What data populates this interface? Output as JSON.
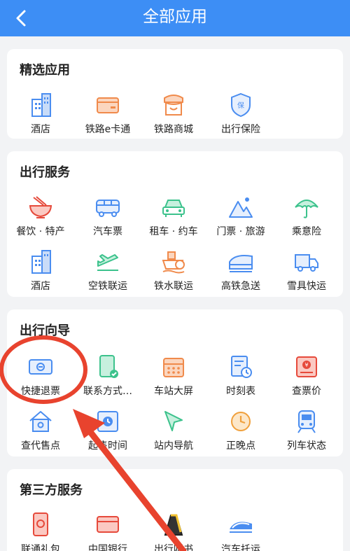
{
  "header": {
    "title": "全部应用",
    "back_icon": "chevron-left-icon"
  },
  "sections": [
    {
      "title": "精选应用",
      "items": [
        "酒店",
        "铁路e卡通",
        "铁路商城",
        "出行保险"
      ]
    },
    {
      "title": "出行服务",
      "items": [
        "餐饮 · 特产",
        "汽车票",
        "租车 · 约车",
        "门票 · 旅游",
        "乘意险",
        "酒店",
        "空铁联运",
        "铁水联运",
        "高铁急送",
        "雪具快运"
      ]
    },
    {
      "title": "出行向导",
      "items": [
        "快捷退票",
        "联系方式…",
        "车站大屏",
        "时刻表",
        "查票价",
        "查代售点",
        "起售时间",
        "站内导航",
        "正晚点",
        "列车状态"
      ]
    },
    {
      "title": "第三方服务",
      "items": [
        "联通礼包",
        "中国银行",
        "出行听书",
        "汽车托运"
      ]
    }
  ],
  "colors": {
    "header": "#3d8ef5",
    "icon_blue": "#4a8df0",
    "icon_orange": "#f08a4b",
    "icon_green": "#3cc28c",
    "icon_red": "#e64a3b",
    "annotation": "#e8432e"
  }
}
